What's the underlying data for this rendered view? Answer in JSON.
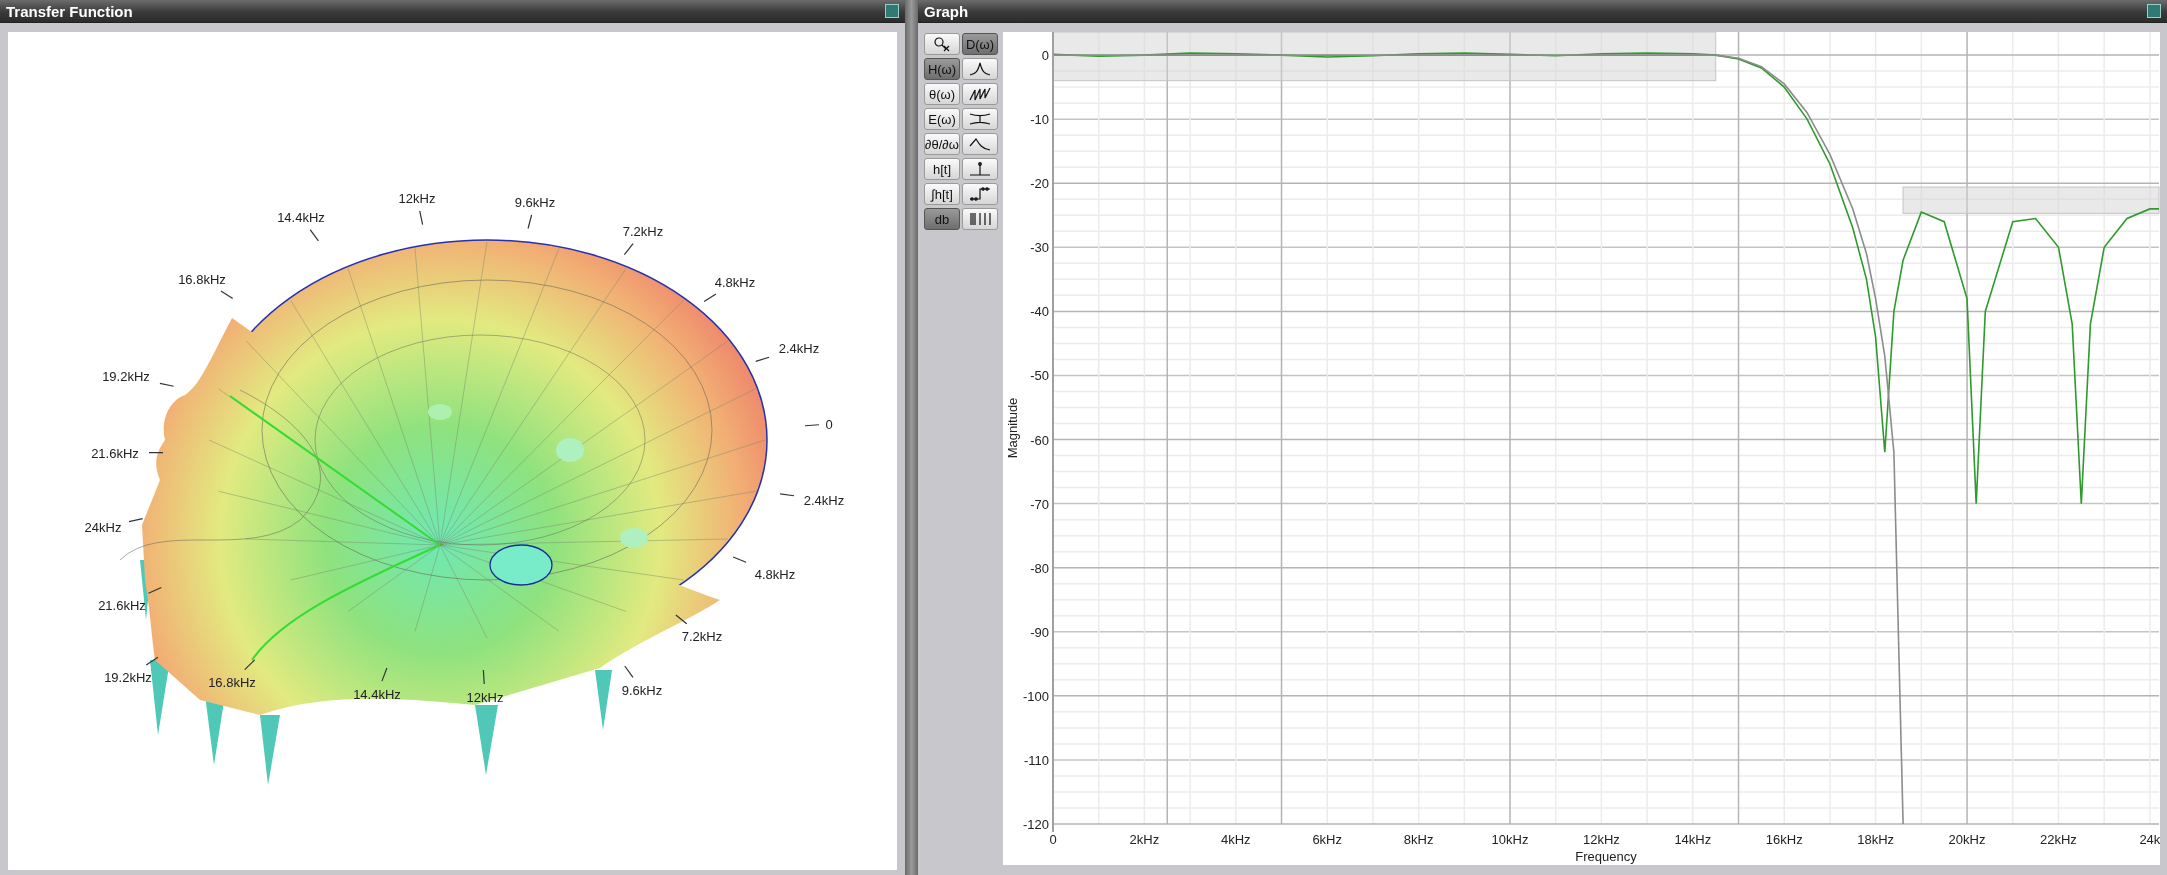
{
  "panels": [
    {
      "title": "Transfer Function"
    },
    {
      "title": "Graph"
    }
  ],
  "surface": {
    "ring_labels": [
      "12kHz",
      "9.6kHz",
      "14.4kHz",
      "7.2kHz",
      "16.8kHz",
      "4.8kHz",
      "2.4kHz",
      "19.2kHz",
      "0",
      "21.6kHz",
      "2.4kHz",
      "24kHz",
      "4.8kHz",
      "21.6kHz",
      "7.2kHz",
      "19.2kHz",
      "9.6kHz",
      "16.8kHz",
      "14.4kHz",
      "12kHz"
    ]
  },
  "toolbar": [
    {
      "kind": "icon",
      "selected": false
    },
    {
      "kind": "text",
      "label": "D(ω)",
      "selected": true
    },
    {
      "kind": "text",
      "label": "H(ω)",
      "selected": true
    },
    {
      "kind": "icon",
      "selected": false
    },
    {
      "kind": "text",
      "label": "θ(ω)",
      "selected": false
    },
    {
      "kind": "icon",
      "selected": false
    },
    {
      "kind": "text",
      "label": "E(ω)",
      "selected": false
    },
    {
      "kind": "icon",
      "selected": false
    },
    {
      "kind": "text",
      "label": "∂θ/∂ω",
      "selected": false
    },
    {
      "kind": "icon",
      "selected": false
    },
    {
      "kind": "text",
      "label": "h[t]",
      "selected": false
    },
    {
      "kind": "icon",
      "selected": false
    },
    {
      "kind": "text",
      "label": "∫h[t]",
      "selected": false
    },
    {
      "kind": "icon",
      "selected": false
    },
    {
      "kind": "text",
      "label": "db",
      "selected": true
    },
    {
      "kind": "icon",
      "selected": false
    }
  ],
  "graph": {
    "chart_data": {
      "type": "line",
      "xlabel": "Frequency",
      "ylabel": "Magnitude",
      "x": [
        0,
        1,
        2,
        3,
        4,
        5,
        6,
        7,
        8,
        9,
        10,
        11,
        12,
        13,
        14,
        14.5,
        15,
        15.5,
        16,
        16.5,
        17,
        17.5,
        17.8,
        18,
        18.2,
        18.4,
        18.6,
        19,
        19.5,
        20,
        20.2,
        20.4,
        21,
        21.5,
        22,
        22.3,
        22.5,
        22.7,
        23,
        23.5,
        24,
        24.2
      ],
      "series": [
        {
          "color": "#2e9a2e",
          "values": [
            0.1,
            -0.2,
            0,
            0.3,
            0.2,
            0,
            -0.3,
            -0.1,
            0.2,
            0.3,
            0.1,
            -0.1,
            0.2,
            0.3,
            0.2,
            0,
            -0.6,
            -2,
            -5,
            -10,
            -17,
            -27,
            -35,
            -44,
            -62,
            -40,
            -32,
            -24.5,
            -26,
            -38,
            -70,
            -40,
            -26,
            -25.5,
            -30,
            -42,
            -70,
            -42,
            -30,
            -25.5,
            -24,
            -24
          ]
        },
        {
          "color": "#8c8c8c",
          "values": [
            0,
            0,
            0,
            0,
            0,
            0,
            0,
            0,
            0,
            0,
            0,
            0,
            0,
            0,
            0,
            0,
            -0.5,
            -1.8,
            -4.5,
            -9,
            -15.5,
            -24,
            -31,
            -38,
            -47,
            -62,
            -120,
            null,
            null,
            null,
            null,
            null,
            null,
            null,
            null,
            null,
            null,
            null,
            null,
            null,
            null,
            null
          ]
        }
      ],
      "xlim": [
        0,
        24.2
      ],
      "ylim": [
        -120,
        3.6
      ],
      "xticks": [
        {
          "value": 0,
          "label": "0"
        },
        {
          "value": 2,
          "label": "2kHz"
        },
        {
          "value": 4,
          "label": "4kHz"
        },
        {
          "value": 6,
          "label": "6kHz"
        },
        {
          "value": 8,
          "label": "8kHz"
        },
        {
          "value": 10,
          "label": "10kHz"
        },
        {
          "value": 12,
          "label": "12kHz"
        },
        {
          "value": 14,
          "label": "14kHz"
        },
        {
          "value": 16,
          "label": "16kHz"
        },
        {
          "value": 18,
          "label": "18kHz"
        },
        {
          "value": 20,
          "label": "20kHz"
        },
        {
          "value": 22,
          "label": "22kHz"
        },
        {
          "value": 24,
          "label": "24k"
        }
      ],
      "yticks": [
        0,
        -10,
        -20,
        -30,
        -40,
        -50,
        -60,
        -70,
        -80,
        -90,
        -100,
        -110,
        -120
      ],
      "grid": true
    }
  }
}
